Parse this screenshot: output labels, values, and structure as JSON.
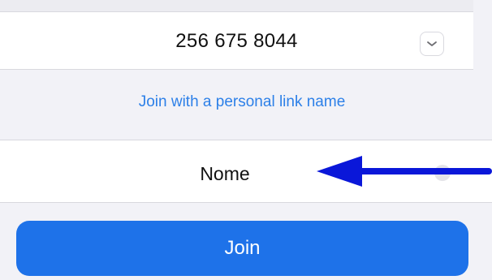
{
  "meeting": {
    "id": "256 675 8044",
    "dropdown_icon": "chevron-down-icon"
  },
  "personal_link": {
    "label": "Join with a personal link name"
  },
  "name_field": {
    "value": "Nome",
    "clear_icon": "clear-icon"
  },
  "annotation": {
    "arrow_icon": "arrow-left-icon",
    "color": "#0a17d9"
  },
  "join_button": {
    "label": "Join",
    "color": "#1e72e9"
  },
  "colors": {
    "link": "#2d80e8",
    "background": "#f2f2f7"
  }
}
